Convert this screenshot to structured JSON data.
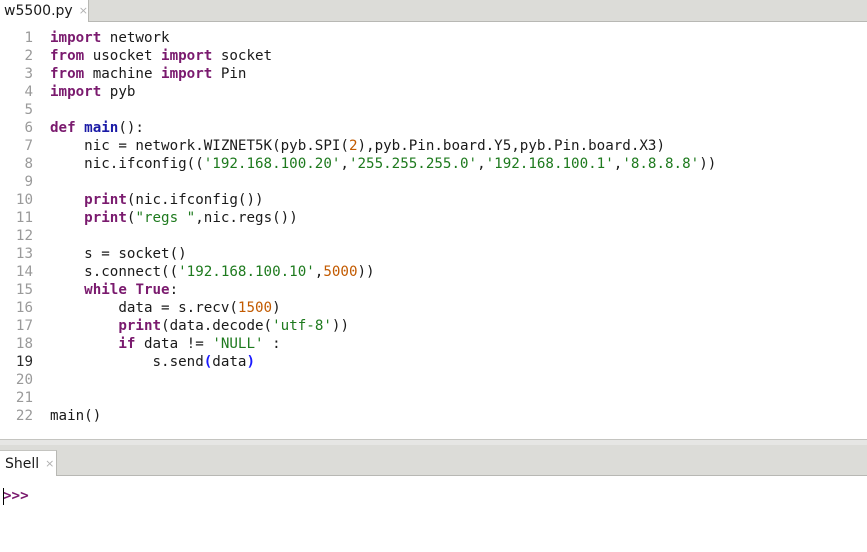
{
  "editor_tab": {
    "filename": "w5500.py",
    "close_glyph": "×"
  },
  "shell_tab": {
    "label": "Shell",
    "close_glyph": "×"
  },
  "shell": {
    "prompt": ">>>"
  },
  "code": {
    "current_line": 19,
    "lines": [
      {
        "n": "1",
        "tokens": [
          [
            "kw",
            "import"
          ],
          [
            "t",
            " network"
          ]
        ]
      },
      {
        "n": "2",
        "tokens": [
          [
            "kw",
            "from"
          ],
          [
            "t",
            " usocket "
          ],
          [
            "kw",
            "import"
          ],
          [
            "t",
            " socket"
          ]
        ]
      },
      {
        "n": "3",
        "tokens": [
          [
            "kw",
            "from"
          ],
          [
            "t",
            " machine "
          ],
          [
            "kw",
            "import"
          ],
          [
            "t",
            " Pin"
          ]
        ]
      },
      {
        "n": "4",
        "tokens": [
          [
            "kw",
            "import"
          ],
          [
            "t",
            " pyb"
          ]
        ]
      },
      {
        "n": "5",
        "tokens": []
      },
      {
        "n": "6",
        "tokens": [
          [
            "kw",
            "def"
          ],
          [
            "t",
            " "
          ],
          [
            "fn",
            "main"
          ],
          [
            "t",
            "():"
          ]
        ]
      },
      {
        "n": "7",
        "tokens": [
          [
            "t",
            "    nic = network.WIZNET5K(pyb.SPI("
          ],
          [
            "num",
            "2"
          ],
          [
            "t",
            "),pyb.Pin.board.Y5,pyb.Pin.board.X3)"
          ]
        ]
      },
      {
        "n": "8",
        "tokens": [
          [
            "t",
            "    nic.ifconfig(("
          ],
          [
            "str",
            "'192.168.100.20'"
          ],
          [
            "t",
            ","
          ],
          [
            "str",
            "'255.255.255.0'"
          ],
          [
            "t",
            ","
          ],
          [
            "str",
            "'192.168.100.1'"
          ],
          [
            "t",
            ","
          ],
          [
            "str",
            "'8.8.8.8'"
          ],
          [
            "t",
            "))"
          ]
        ]
      },
      {
        "n": "9",
        "tokens": []
      },
      {
        "n": "10",
        "tokens": [
          [
            "t",
            "    "
          ],
          [
            "kw2",
            "print"
          ],
          [
            "t",
            "(nic.ifconfig())"
          ]
        ]
      },
      {
        "n": "11",
        "tokens": [
          [
            "t",
            "    "
          ],
          [
            "kw2",
            "print"
          ],
          [
            "t",
            "("
          ],
          [
            "str",
            "\"regs \""
          ],
          [
            "t",
            ",nic.regs())"
          ]
        ]
      },
      {
        "n": "12",
        "tokens": []
      },
      {
        "n": "13",
        "tokens": [
          [
            "t",
            "    s = socket()"
          ]
        ]
      },
      {
        "n": "14",
        "tokens": [
          [
            "t",
            "    s.connect(("
          ],
          [
            "str",
            "'192.168.100.10'"
          ],
          [
            "t",
            ","
          ],
          [
            "num",
            "5000"
          ],
          [
            "t",
            "))"
          ]
        ]
      },
      {
        "n": "15",
        "tokens": [
          [
            "t",
            "    "
          ],
          [
            "kw",
            "while"
          ],
          [
            "t",
            " "
          ],
          [
            "kw",
            "True"
          ],
          [
            "t",
            ":"
          ]
        ]
      },
      {
        "n": "16",
        "tokens": [
          [
            "t",
            "        data = s.recv("
          ],
          [
            "num",
            "1500"
          ],
          [
            "t",
            ")"
          ]
        ]
      },
      {
        "n": "17",
        "tokens": [
          [
            "t",
            "        "
          ],
          [
            "kw2",
            "print"
          ],
          [
            "t",
            "(data.decode("
          ],
          [
            "str",
            "'utf-8'"
          ],
          [
            "t",
            "))"
          ]
        ]
      },
      {
        "n": "18",
        "tokens": [
          [
            "t",
            "        "
          ],
          [
            "kw",
            "if"
          ],
          [
            "t",
            " data != "
          ],
          [
            "str",
            "'NULL'"
          ],
          [
            "t",
            " :"
          ]
        ]
      },
      {
        "n": "19",
        "tokens": [
          [
            "t",
            "            s.send"
          ],
          [
            "ph",
            "("
          ],
          [
            "t",
            "data"
          ],
          [
            "ph",
            ")"
          ]
        ]
      },
      {
        "n": "20",
        "tokens": []
      },
      {
        "n": "21",
        "tokens": []
      },
      {
        "n": "22",
        "tokens": [
          [
            "t",
            "main()"
          ]
        ]
      }
    ]
  }
}
